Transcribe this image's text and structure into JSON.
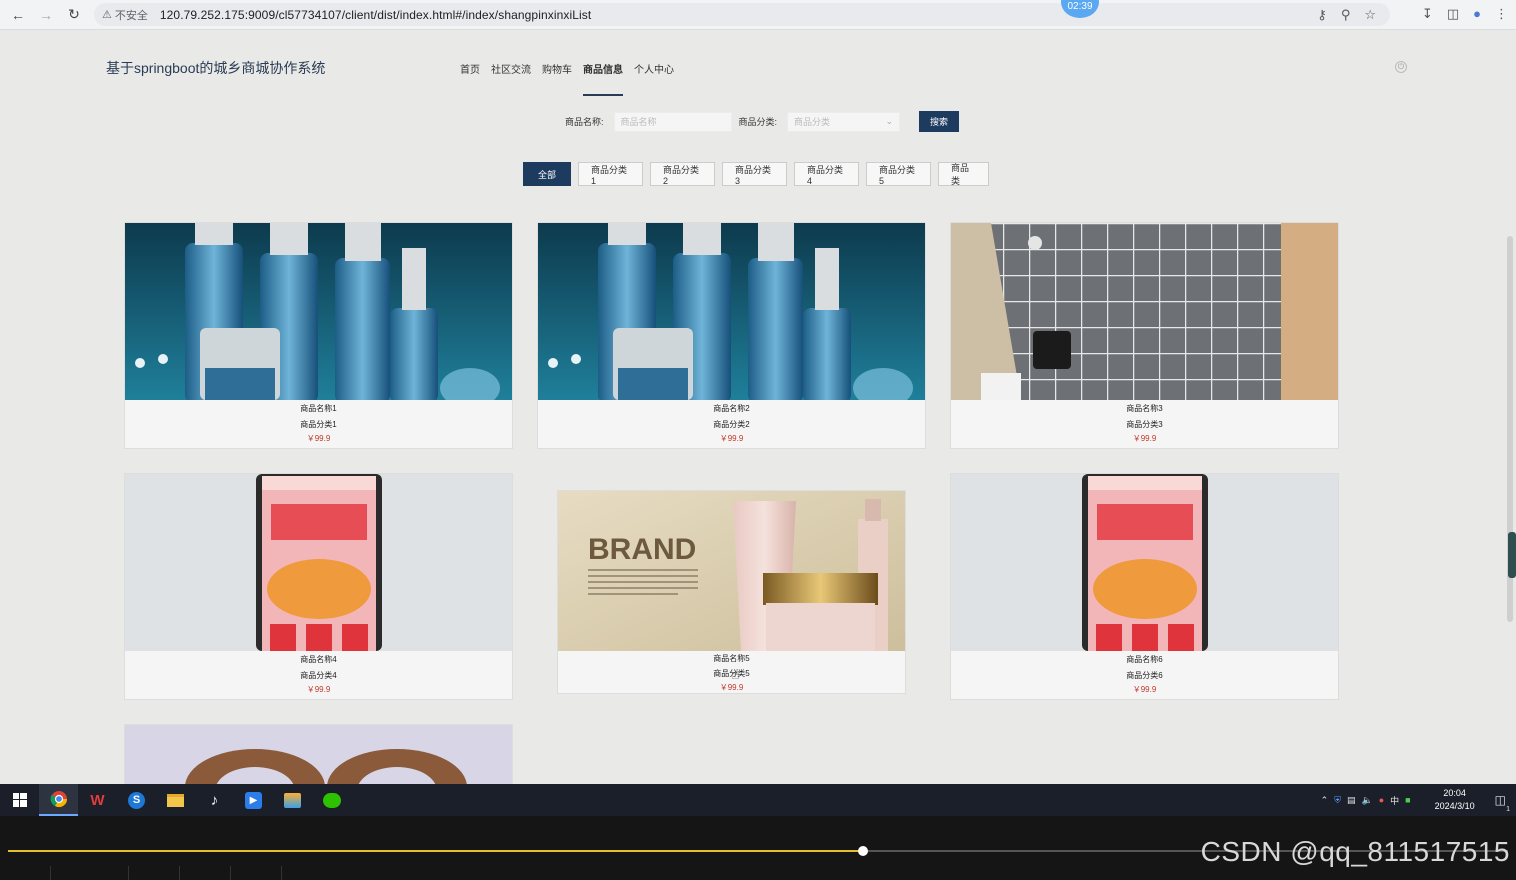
{
  "browser": {
    "insecure_label": "不安全",
    "url": "120.79.252.175:9009/cl57734107/client/dist/index.html#/index/shangpinxinxiList",
    "timer": "02:39"
  },
  "site": {
    "title": "基于springboot的城乡商城协作系统",
    "nav": [
      "首页",
      "社区交流",
      "购物车",
      "商品信息",
      "个人中心"
    ],
    "active_nav_index": 3
  },
  "search": {
    "name_label": "商品名称:",
    "name_placeholder": "商品名称",
    "category_label": "商品分类:",
    "category_placeholder": "商品分类",
    "button": "搜索"
  },
  "categories": [
    "全部",
    "商品分类1",
    "商品分类2",
    "商品分类3",
    "商品分类4",
    "商品分类5",
    "商品类"
  ],
  "products": [
    {
      "name": "商品名称1",
      "category": "商品分类1",
      "price": "￥99.9",
      "image": "cosmetics-bottles"
    },
    {
      "name": "商品名称2",
      "category": "商品分类2",
      "price": "￥99.9",
      "image": "cosmetics-bottles"
    },
    {
      "name": "商品名称3",
      "category": "商品分类3",
      "price": "￥99.9",
      "image": "plaid-cushion"
    },
    {
      "name": "商品名称4",
      "category": "商品分类4",
      "price": "￥99.9",
      "image": "phone-poster"
    },
    {
      "name": "商品名称5",
      "category": "商品分类5",
      "price": "￥99.9",
      "image": "brand-cream"
    },
    {
      "name": "商品名称6",
      "category": "商品分类6",
      "price": "￥99.9",
      "image": "phone-poster"
    }
  ],
  "poster_text": "BRAND",
  "taskbar": {
    "time": "20:04",
    "date": "2024/3/10",
    "ime": "中",
    "notification_count": "1"
  },
  "player": {
    "progress": 0.57,
    "watermark": "CSDN @qq_811517515"
  }
}
